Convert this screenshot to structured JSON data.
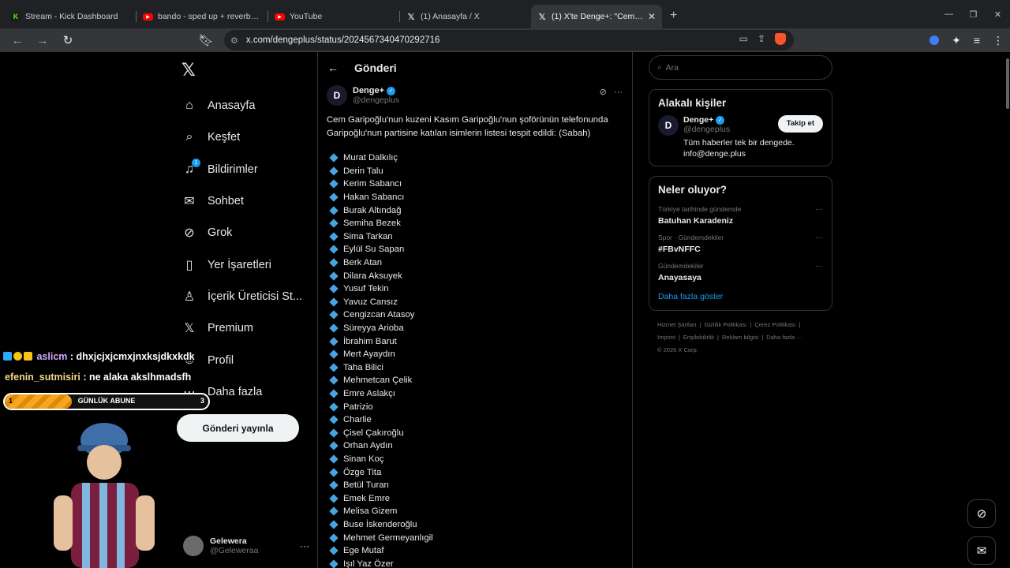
{
  "browser": {
    "tabs": [
      {
        "icon": "kick-favicon",
        "title": "Stream - Kick Dashboard",
        "active": false
      },
      {
        "icon": "youtube-favicon",
        "title": "bando - sped up + reverb - YouTube",
        "active": false
      },
      {
        "icon": "youtube-favicon",
        "title": "YouTube",
        "active": false
      },
      {
        "icon": "x-favicon",
        "title": "(1) Anasayfa / X",
        "active": false
      },
      {
        "icon": "x-favicon",
        "title": "(1) X'te Denge+: \"Cem Garipo",
        "active": true
      }
    ],
    "url": "x.com/dengeplus/status/2024567340470292716"
  },
  "sidebar": {
    "items": [
      {
        "label": "Anasayfa",
        "icon": "home-icon"
      },
      {
        "label": "Keşfet",
        "icon": "search-icon"
      },
      {
        "label": "Bildirimler",
        "icon": "bell-icon",
        "badge": "1"
      },
      {
        "label": "Sohbet",
        "icon": "mail-icon"
      },
      {
        "label": "Grok",
        "icon": "grok-icon"
      },
      {
        "label": "Yer İşaretleri",
        "icon": "bookmark-icon"
      },
      {
        "label": "İçerik Üreticisi St...",
        "icon": "creator-icon"
      },
      {
        "label": "Premium",
        "icon": "x-icon"
      },
      {
        "label": "Profil",
        "icon": "person-icon"
      },
      {
        "label": "Daha fazla",
        "icon": "more-icon"
      }
    ],
    "post_button": "Gönderi yayınla",
    "account": {
      "name": "Gelewera",
      "handle": "@Geleweraa"
    }
  },
  "post": {
    "header": "Gönderi",
    "author_name": "Denge+",
    "author_handle": "@dengeplus",
    "text": "Cem Garipoğlu'nun kuzeni Kasım Garipoğlu'nun şoförünün telefonunda Garipoğlu'nun partisine katılan isimlerin listesi tespit edildi: (Sabah)",
    "names": [
      "Murat Dalkılıç",
      "Derin Talu",
      "Kerim Sabancı",
      "Hakan Sabancı",
      "Burak Altındağ",
      "Semiha Bezek",
      "Sima Tarkan",
      "Eylül Su Sapan",
      "Berk Atan",
      "Dilara Aksuyek",
      "Yusuf Tekin",
      "Yavuz Cansız",
      "Cengizcan Atasoy",
      "Süreyya Arioba",
      "İbrahim Barut",
      "Mert Ayaydın",
      "Taha Bilici",
      "Mehmetcan Çelik",
      "Emre Aslakçı",
      "Patrizio",
      "Charlie",
      "Çisel Çakıroğlu",
      "Orhan Aydın",
      "Sinan Koç",
      "Özge Tita",
      "Betül Turan",
      "Emek Emre",
      "Melisa Gizem",
      "Buse İskenderoğlu",
      "Mehmet Germeyanlıgil",
      "Ege Mutaf",
      "Işıl Yaz Özer"
    ]
  },
  "right": {
    "search_placeholder": "Ara",
    "relevant": {
      "title": "Alakalı kişiler",
      "name": "Denge+",
      "handle": "@dengeplus",
      "bio": "Tüm haberler tek bir dengede. info@denge.plus",
      "follow": "Takip et"
    },
    "trends": {
      "title": "Neler oluyor?",
      "items": [
        {
          "context": "Türkiye tarihinde gündemde",
          "name": "Batuhan Karadeniz"
        },
        {
          "context": "Spor · Gündemdekiler",
          "name": "#FBvNFFC"
        },
        {
          "context": "Gündemdekiler",
          "name": "Anayasaya"
        }
      ],
      "show_more": "Daha fazla göster"
    },
    "footer": {
      "line1": [
        "Hizmet Şartları",
        "|",
        "Gizlilik Politikası",
        "|",
        "Çerez Politikası",
        "|"
      ],
      "line2": [
        "Imprint",
        "|",
        "Erişilebilirlik",
        "|",
        "Reklam bilgisi",
        "|",
        "Daha fazla ···"
      ],
      "line3": "© 2026 X Corp."
    }
  },
  "overlay": {
    "chat": [
      {
        "user": "aslicm",
        "message": ": dhxjcjxjcmxjnxksjdkxkdk"
      },
      {
        "user": "efenin_sutmisiri",
        "message": ": ne alaka akslhmadsfh"
      }
    ],
    "goal": {
      "label": "GÜNLÜK ABUNE",
      "current": "1",
      "target": "3",
      "progress": 0.33
    }
  },
  "colors": {
    "accent": "#1d9bf0",
    "background": "#000000",
    "bullet": "#4aa3df",
    "goal_fill": "#f5a623"
  }
}
